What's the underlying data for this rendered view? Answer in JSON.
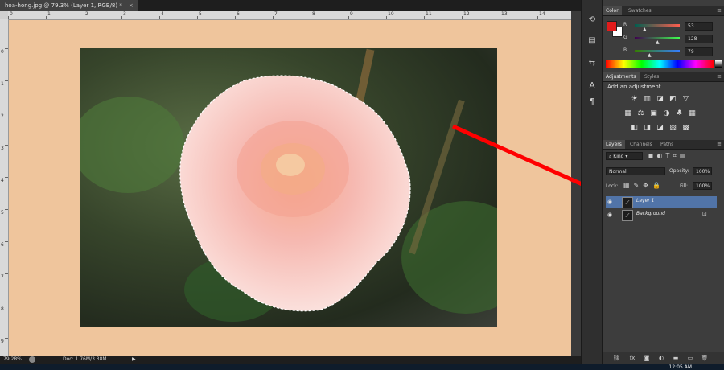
{
  "document": {
    "tab_title": "hoa-hong.jpg @ 79.3% (Layer 1, RGB/8) *",
    "close_glyph": "×",
    "canvas_color": "#efc59c"
  },
  "rulers": {
    "top": [
      "0",
      "1",
      "2",
      "3",
      "4",
      "5",
      "6",
      "7",
      "8",
      "9",
      "10",
      "11",
      "12",
      "13",
      "14",
      "15"
    ],
    "left": [
      "0",
      "1",
      "2",
      "3",
      "4",
      "5",
      "6",
      "7",
      "8",
      "9"
    ]
  },
  "status": {
    "zoom": "79.28%",
    "doc": "Doc: 1.76M/3.38M",
    "arrow": "▶"
  },
  "taskbar": {
    "clock": "12:05 AM"
  },
  "tools": [
    "history-icon",
    "brush-presets-icon",
    "clone-source-icon",
    "character-icon",
    "paragraph-icon",
    "properties-icon"
  ],
  "color_panel": {
    "tabs": [
      "Color",
      "Swatches"
    ],
    "foreground": "#e11b1b",
    "background": "#ffffff",
    "channels": [
      {
        "label": "R",
        "value": "53",
        "knob": 0.21,
        "gradient": "linear-gradient(90deg,#005e4f,#ff5e4f)"
      },
      {
        "label": "G",
        "value": "128",
        "knob": 0.5,
        "gradient": "linear-gradient(90deg,#3f004f,#3fff4f)"
      },
      {
        "label": "B",
        "value": "79",
        "knob": 0.31,
        "gradient": "linear-gradient(90deg,#357e00,#357eff)"
      }
    ]
  },
  "adjustments_panel": {
    "tabs": [
      "Adjustments",
      "Styles"
    ],
    "heading": "Add an adjustment",
    "row1": [
      "☀",
      "▥",
      "◪",
      "◩",
      "▽"
    ],
    "row2": [
      "▦",
      "⚖",
      "▣",
      "◑",
      "♣",
      "▦"
    ],
    "row3": [
      "◧",
      "◨",
      "◪",
      "▧",
      "▩"
    ]
  },
  "layers_panel": {
    "tabs": [
      "Layers",
      "Channels",
      "Paths"
    ],
    "kind": "Kind",
    "blend_mode": "Normal",
    "opacity_label": "Opacity:",
    "opacity_value": "100%",
    "lock_label": "Lock:",
    "fill_label": "Fill:",
    "fill_value": "100%",
    "layers": [
      {
        "name": "Layer 1",
        "selected": true
      },
      {
        "name": "Background",
        "selected": false
      }
    ],
    "highlight_color": "#ff0000"
  },
  "annotation": {
    "arrow_color": "#ff0000"
  }
}
